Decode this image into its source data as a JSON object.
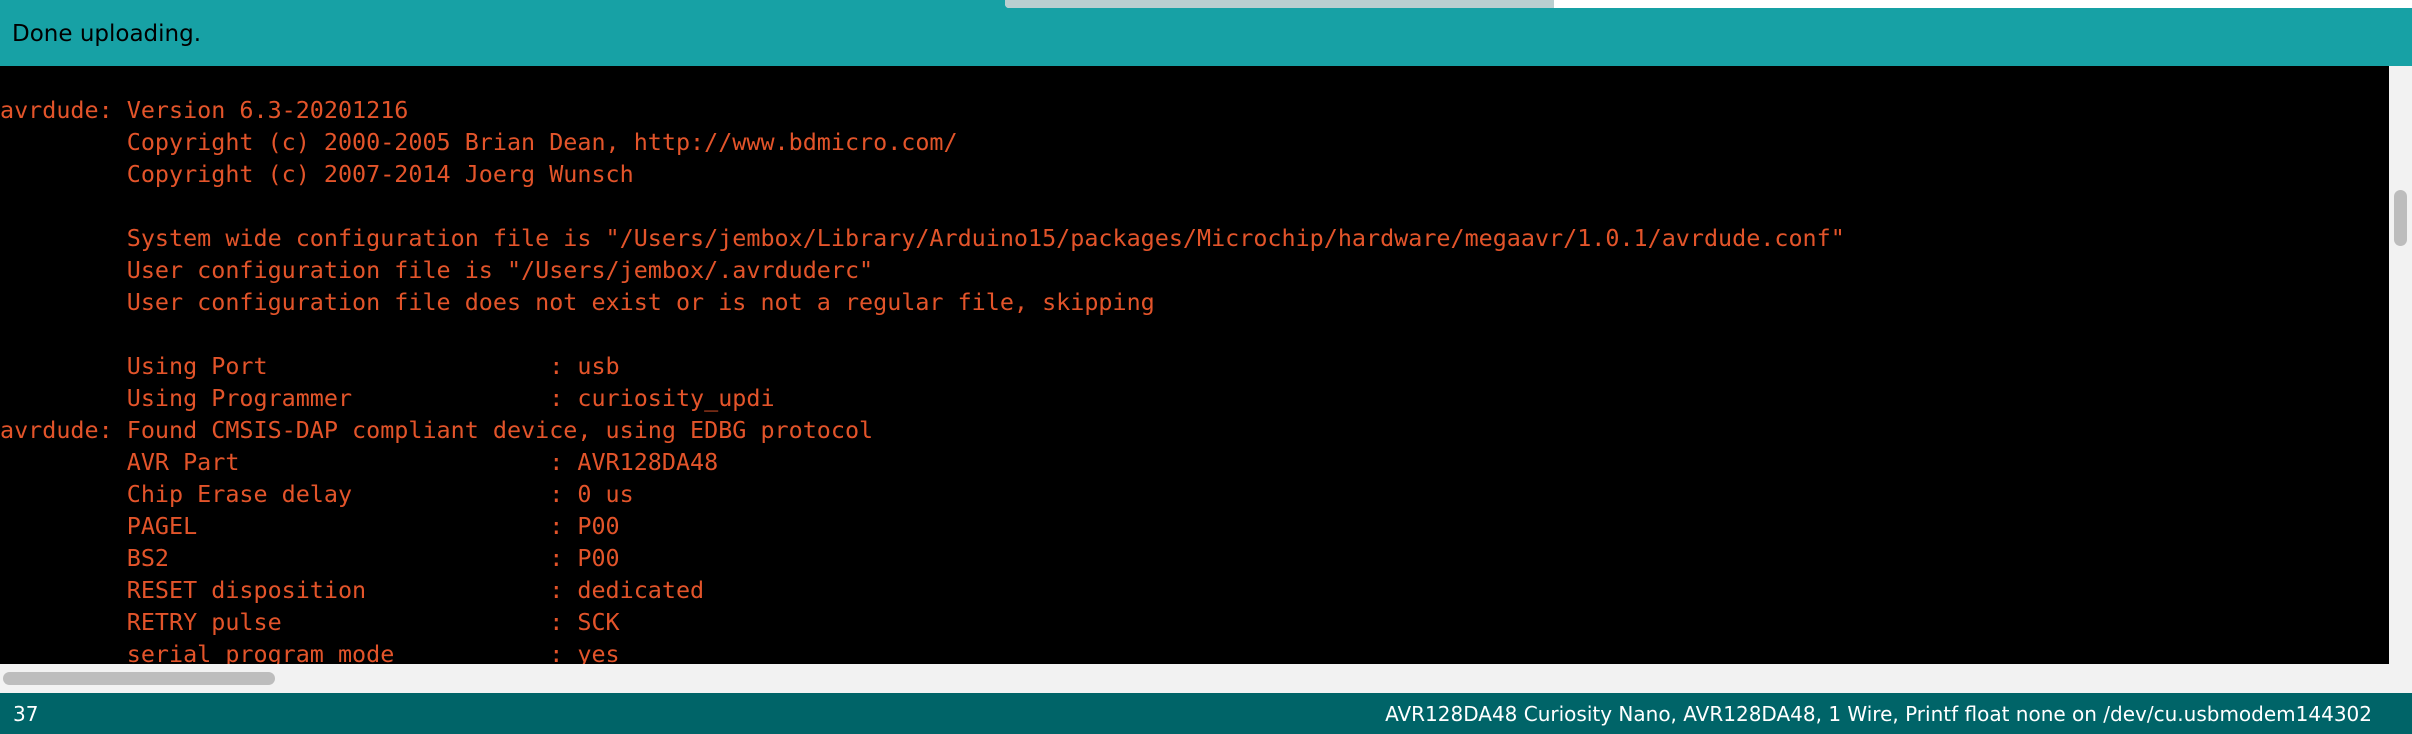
{
  "status_bar": {
    "message": "Done uploading.",
    "progress": 0.39
  },
  "console": {
    "lines": [
      "avrdude: Version 6.3-20201216",
      "         Copyright (c) 2000-2005 Brian Dean, http://www.bdmicro.com/",
      "         Copyright (c) 2007-2014 Joerg Wunsch",
      "",
      "         System wide configuration file is \"/Users/jembox/Library/Arduino15/packages/Microchip/hardware/megaavr/1.0.1/avrdude.conf\"",
      "         User configuration file is \"/Users/jembox/.avrduderc\"",
      "         User configuration file does not exist or is not a regular file, skipping",
      "",
      "         Using Port                    : usb",
      "         Using Programmer              : curiosity_updi",
      "avrdude: Found CMSIS-DAP compliant device, using EDBG protocol",
      "         AVR Part                      : AVR128DA48",
      "         Chip Erase delay              : 0 us",
      "         PAGEL                         : P00",
      "         BS2                           : P00",
      "         RESET disposition             : dedicated",
      "         RETRY pulse                   : SCK",
      "         serial program mode           : yes"
    ],
    "text_color": "#e3542a",
    "background_color": "#000000"
  },
  "bottom_bar": {
    "line_number": "37",
    "board_info": "AVR128DA48 Curiosity Nano, AVR128DA48, 1 Wire, Printf float none on /dev/cu.usbmodem144302"
  },
  "colors": {
    "status_bar": "#17a1a5",
    "bottom_bar": "#006468"
  }
}
